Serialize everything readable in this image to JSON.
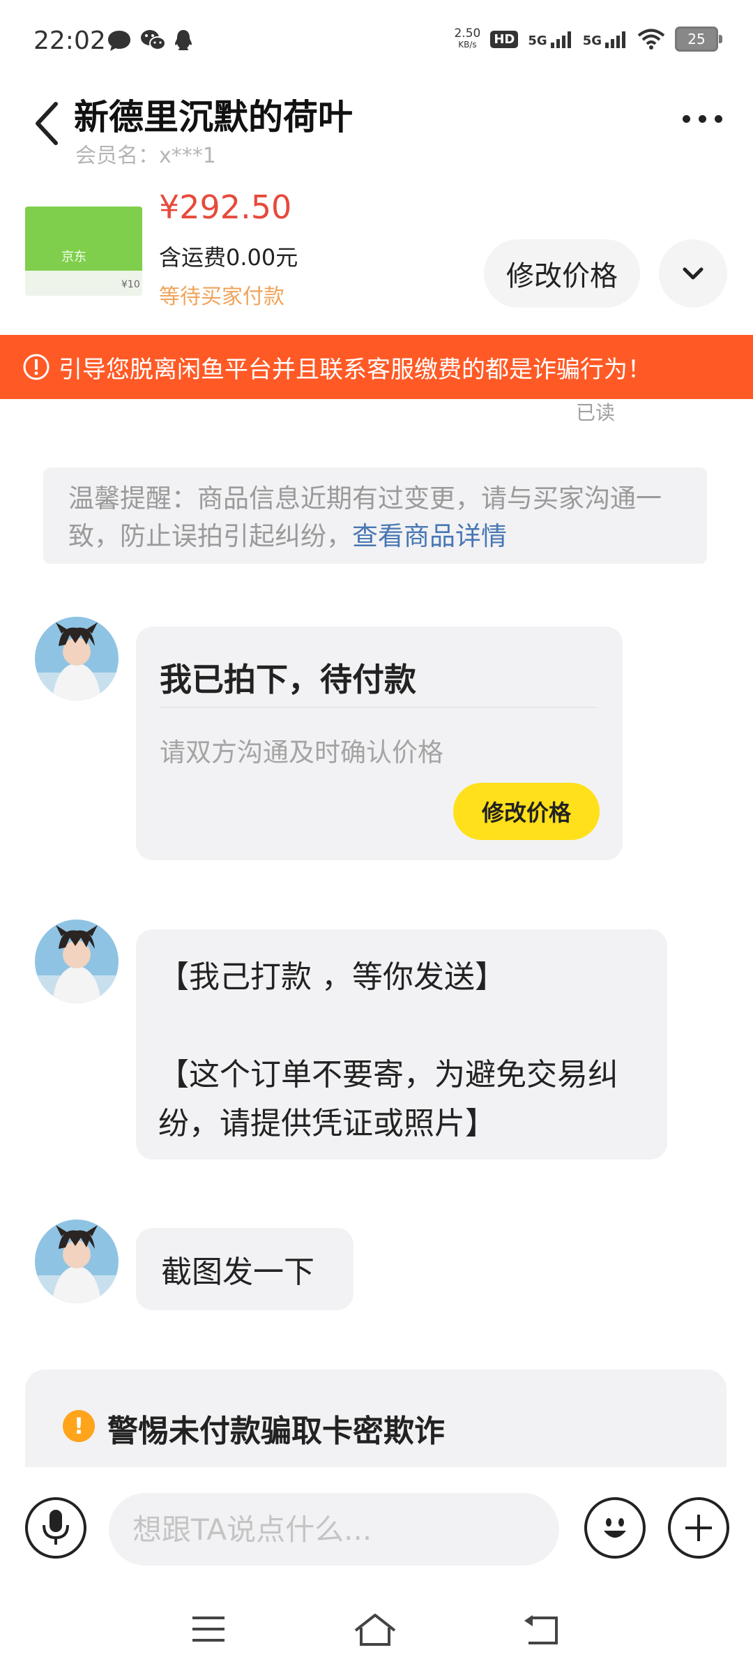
{
  "status_bar": {
    "time": "22:02",
    "net_speed_value": "2.50",
    "net_speed_unit": "KB/s",
    "hd": "HD",
    "sim1": "5G",
    "sim2": "5G",
    "battery": "25"
  },
  "header": {
    "title": "新德里沉默的荷叶",
    "member_label": "会员名：x***1"
  },
  "product": {
    "thumb_brand": "京东",
    "thumb_face": "¥10",
    "price": "¥292.50",
    "shipping": "含运费0.00元",
    "status": "等待买家付款",
    "modify_price": "修改价格"
  },
  "warning_banner": {
    "text": "引导您脱离闲鱼平台并且联系客服缴费的都是诈骗行为！"
  },
  "read_status": "已读",
  "tip": {
    "text": "温馨提醒：商品信息近期有过变更，请与买家沟通一致，防止误拍引起纠纷，",
    "link": "查看商品详情"
  },
  "messages": {
    "card": {
      "title": "我已拍下，待付款",
      "subtitle": "请双方沟通及时确认价格",
      "button": "修改价格"
    },
    "msg2_line1": "【我己打款 ，等你发送】",
    "msg2_line2": "【这个订单不要寄，为避免交易纠纷，请提供凭证或照片】",
    "msg3": "截图发一下"
  },
  "alert": {
    "icon": "!",
    "text": "警惕未付款骗取卡密欺诈"
  },
  "input": {
    "placeholder": "想跟TA说点什么..."
  },
  "colors": {
    "accent_yellow": "#ffe01a",
    "warning_orange": "#ff5a26",
    "price_red": "#e64a3b",
    "link_blue": "#4777b3"
  }
}
